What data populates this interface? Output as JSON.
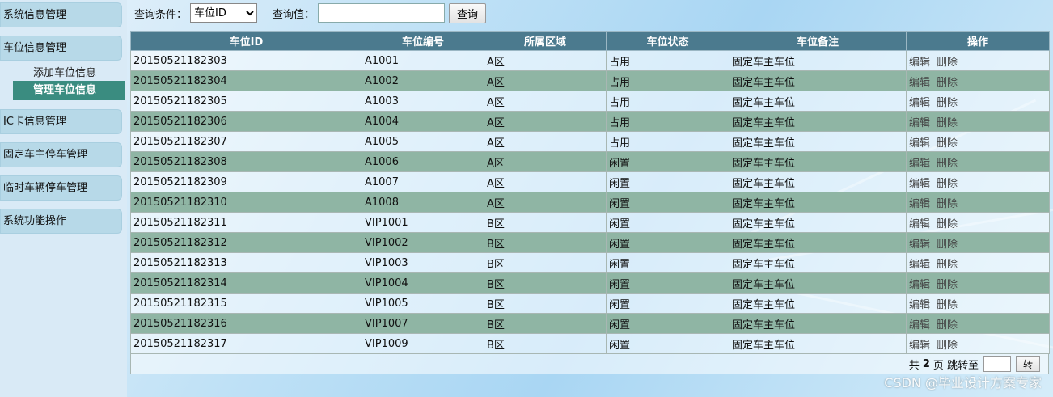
{
  "sidebar": {
    "menu": [
      {
        "label": "系统信息管理"
      },
      {
        "label": "车位信息管理"
      },
      {
        "label": "IC卡信息管理"
      },
      {
        "label": "固定车主停车管理"
      },
      {
        "label": "临时车辆停车管理"
      },
      {
        "label": "系统功能操作"
      }
    ],
    "sub": {
      "add": "添加车位信息",
      "manage": "管理车位信息"
    }
  },
  "search": {
    "condition_label": "查询条件：",
    "selected": "车位ID",
    "value_label": "查询值：",
    "value": "",
    "button": "查询"
  },
  "table": {
    "headers": [
      "车位ID",
      "车位编号",
      "所属区域",
      "车位状态",
      "车位备注",
      "操作"
    ],
    "edit": "编辑",
    "delete": "删除",
    "rows": [
      [
        "20150521182303",
        "A1001",
        "A区",
        "占用",
        "固定车主车位"
      ],
      [
        "20150521182304",
        "A1002",
        "A区",
        "占用",
        "固定车主车位"
      ],
      [
        "20150521182305",
        "A1003",
        "A区",
        "占用",
        "固定车主车位"
      ],
      [
        "20150521182306",
        "A1004",
        "A区",
        "占用",
        "固定车主车位"
      ],
      [
        "20150521182307",
        "A1005",
        "A区",
        "占用",
        "固定车主车位"
      ],
      [
        "20150521182308",
        "A1006",
        "A区",
        "闲置",
        "固定车主车位"
      ],
      [
        "20150521182309",
        "A1007",
        "A区",
        "闲置",
        "固定车主车位"
      ],
      [
        "20150521182310",
        "A1008",
        "A区",
        "闲置",
        "固定车主车位"
      ],
      [
        "20150521182311",
        "VIP1001",
        "B区",
        "闲置",
        "固定车主车位"
      ],
      [
        "20150521182312",
        "VIP1002",
        "B区",
        "闲置",
        "固定车主车位"
      ],
      [
        "20150521182313",
        "VIP1003",
        "B区",
        "闲置",
        "固定车主车位"
      ],
      [
        "20150521182314",
        "VIP1004",
        "B区",
        "闲置",
        "固定车主车位"
      ],
      [
        "20150521182315",
        "VIP1005",
        "B区",
        "闲置",
        "固定车主车位"
      ],
      [
        "20150521182316",
        "VIP1007",
        "B区",
        "闲置",
        "固定车主车位"
      ],
      [
        "20150521182317",
        "VIP1009",
        "B区",
        "闲置",
        "固定车主车位"
      ]
    ]
  },
  "pager": {
    "prefix": "共",
    "total": "2",
    "suffix": "页 跳转至",
    "button": "转"
  },
  "watermark": "CSDN @毕业设计方案专家"
}
